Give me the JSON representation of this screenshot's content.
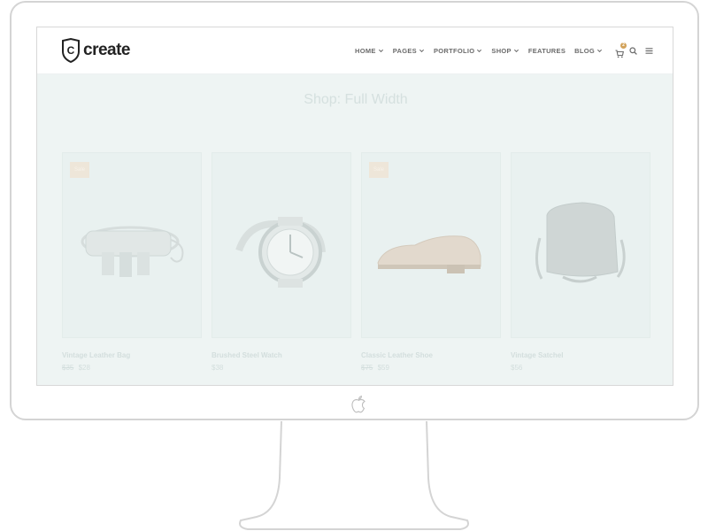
{
  "site": {
    "logo_letter": "C",
    "logo_text": "create"
  },
  "nav": {
    "items": [
      {
        "label": "HOME",
        "has_dropdown": true
      },
      {
        "label": "PAGES",
        "has_dropdown": true
      },
      {
        "label": "PORTFOLIO",
        "has_dropdown": true
      },
      {
        "label": "SHOP",
        "has_dropdown": true
      },
      {
        "label": "FEATURES",
        "has_dropdown": false
      },
      {
        "label": "BLOG",
        "has_dropdown": true
      }
    ],
    "cart_count": "2",
    "icons": [
      "cart-icon",
      "search-icon",
      "menu-icon"
    ]
  },
  "page": {
    "title": "Shop: Full Width"
  },
  "products": [
    {
      "name": "Vintage Leather Bag",
      "old_price": "$35",
      "price": "$28",
      "on_sale": true,
      "sale_label": "Sale",
      "image": "bag-image"
    },
    {
      "name": "Brushed Steel Watch",
      "old_price": "",
      "price": "$38",
      "on_sale": false,
      "sale_label": "",
      "image": "watch-image"
    },
    {
      "name": "Classic Leather Shoe",
      "old_price": "$75",
      "price": "$59",
      "on_sale": true,
      "sale_label": "Sale",
      "image": "shoe-image"
    },
    {
      "name": "Vintage Satchel",
      "old_price": "",
      "price": "$56",
      "on_sale": false,
      "sale_label": "",
      "image": "satchel-image"
    }
  ],
  "colors": {
    "accent": "#d2a25a",
    "nav_text": "#6b6b6b",
    "page_bg": "#eef4f3",
    "frame": "#d4d4d4"
  }
}
